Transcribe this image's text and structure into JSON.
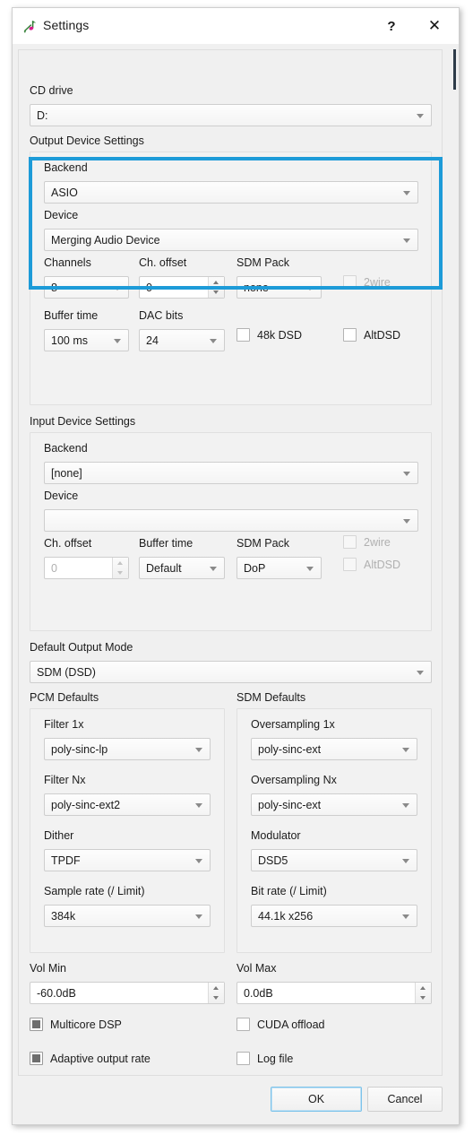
{
  "window": {
    "title": "Settings",
    "icon": "music-note-icon",
    "help_label": "?",
    "close_label": "✕"
  },
  "cd_drive": {
    "label": "CD drive",
    "value": "D:"
  },
  "output": {
    "section_label": "Output Device Settings",
    "backend_label": "Backend",
    "backend_value": "ASIO",
    "device_label": "Device",
    "device_value": "Merging Audio Device",
    "channels_label": "Channels",
    "channels_value": "8",
    "ch_offset_label": "Ch. offset",
    "ch_offset_value": "0",
    "sdm_pack_label": "SDM Pack",
    "sdm_pack_value": "none",
    "twowire_label": "2wire",
    "buffer_time_label": "Buffer time",
    "buffer_time_value": "100 ms",
    "dac_bits_label": "DAC bits",
    "dac_bits_value": "24",
    "dsd48k_label": "48k DSD",
    "altdsd_label": "AltDSD"
  },
  "input": {
    "section_label": "Input Device Settings",
    "backend_label": "Backend",
    "backend_value": "[none]",
    "device_label": "Device",
    "device_value": "",
    "ch_offset_label": "Ch. offset",
    "ch_offset_value": "0",
    "buffer_time_label": "Buffer time",
    "buffer_time_value": "Default",
    "sdm_pack_label": "SDM Pack",
    "sdm_pack_value": "DoP",
    "twowire_label": "2wire",
    "altdsd_label": "AltDSD"
  },
  "default_output_mode": {
    "label": "Default Output Mode",
    "value": "SDM (DSD)"
  },
  "pcm_defaults": {
    "section_label": "PCM Defaults",
    "filter1x_label": "Filter 1x",
    "filter1x_value": "poly-sinc-lp",
    "filternx_label": "Filter Nx",
    "filternx_value": "poly-sinc-ext2",
    "dither_label": "Dither",
    "dither_value": "TPDF",
    "sample_rate_label": "Sample rate (/ Limit)",
    "sample_rate_value": "384k"
  },
  "sdm_defaults": {
    "section_label": "SDM Defaults",
    "oversampling1x_label": "Oversampling 1x",
    "oversampling1x_value": "poly-sinc-ext",
    "oversamplingnx_label": "Oversampling Nx",
    "oversamplingnx_value": "poly-sinc-ext",
    "modulator_label": "Modulator",
    "modulator_value": "DSD5",
    "bit_rate_label": "Bit rate (/ Limit)",
    "bit_rate_value": "44.1k x256"
  },
  "volume": {
    "min_label": "Vol Min",
    "min_value": "-60.0dB",
    "max_label": "Vol Max",
    "max_value": "0.0dB"
  },
  "options": {
    "multicore_dsp_label": "Multicore DSP",
    "cuda_offload_label": "CUDA offload",
    "adaptive_output_rate_label": "Adaptive output rate",
    "log_file_label": "Log file"
  },
  "footer": {
    "ok_label": "OK",
    "cancel_label": "Cancel"
  },
  "colors": {
    "highlight": "#1d9bd8",
    "window_bg": "#f0f0f0",
    "accent_focus": "#7cc3ea"
  }
}
